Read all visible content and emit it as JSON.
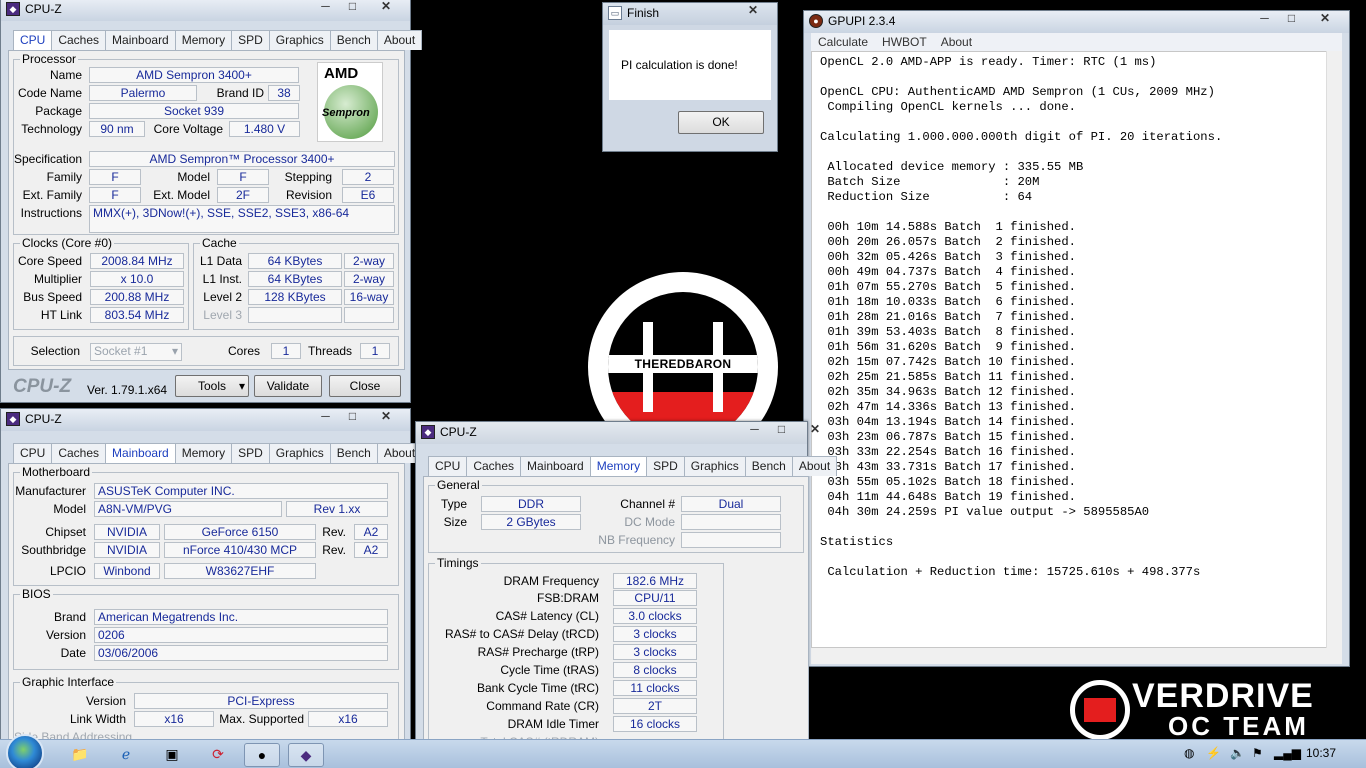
{
  "cpuz_cpu": {
    "title": "CPU-Z",
    "tabs": [
      "CPU",
      "Caches",
      "Mainboard",
      "Memory",
      "SPD",
      "Graphics",
      "Bench",
      "About"
    ],
    "processor_group": "Processor",
    "name_label": "Name",
    "name": "AMD Sempron 3400+",
    "codename_label": "Code Name",
    "codename": "Palermo",
    "brandid_label": "Brand ID",
    "brandid": "38",
    "package_label": "Package",
    "package": "Socket 939",
    "technology_label": "Technology",
    "technology": "90 nm",
    "voltage_label": "Core Voltage",
    "voltage": "1.480 V",
    "spec_label": "Specification",
    "spec": "AMD Sempron™ Processor 3400+",
    "family_label": "Family",
    "family": "F",
    "model_label": "Model",
    "model": "F",
    "stepping_label": "Stepping",
    "stepping": "2",
    "extfamily_label": "Ext. Family",
    "extfamily": "F",
    "extmodel_label": "Ext. Model",
    "extmodel": "2F",
    "revision_label": "Revision",
    "revision": "E6",
    "instructions_label": "Instructions",
    "instructions": "MMX(+), 3DNow!(+), SSE, SSE2, SSE3, x86-64",
    "logo_top": "AMD",
    "logo_bottom": "Sempron",
    "clocks_group": "Clocks (Core #0)",
    "corespeed_label": "Core Speed",
    "corespeed": "2008.84 MHz",
    "multiplier_label": "Multiplier",
    "multiplier": "x 10.0",
    "busspeed_label": "Bus Speed",
    "busspeed": "200.88 MHz",
    "htlink_label": "HT Link",
    "htlink": "803.54 MHz",
    "cache_group": "Cache",
    "l1d_label": "L1 Data",
    "l1d": "64 KBytes",
    "l1d_way": "2-way",
    "l1i_label": "L1 Inst.",
    "l1i": "64 KBytes",
    "l1i_way": "2-way",
    "l2_label": "Level 2",
    "l2": "128 KBytes",
    "l2_way": "16-way",
    "l3_label": "Level 3",
    "selection_label": "Selection",
    "selection": "Socket #1",
    "cores_label": "Cores",
    "cores": "1",
    "threads_label": "Threads",
    "threads": "1",
    "brand": "CPU-Z",
    "version": "Ver. 1.79.1.x64",
    "tools": "Tools",
    "validate": "Validate",
    "close": "Close"
  },
  "finish": {
    "title": "Finish",
    "message": "PI calculation is done!",
    "ok": "OK"
  },
  "gpupi": {
    "title": "GPUPI 2.3.4",
    "menu": [
      "Calculate",
      "HWBOT",
      "About"
    ],
    "log": "OpenCL 2.0 AMD-APP is ready. Timer: RTC (1 ms)\n\nOpenCL CPU: AuthenticAMD AMD Sempron (1 CUs, 2009 MHz)\n Compiling OpenCL kernels ... done.\n\nCalculating 1.000.000.000th digit of PI. 20 iterations.\n\n Allocated device memory : 335.55 MB\n Batch Size              : 20M\n Reduction Size          : 64\n\n 00h 10m 14.588s Batch  1 finished.\n 00h 20m 26.057s Batch  2 finished.\n 00h 32m 05.426s Batch  3 finished.\n 00h 49m 04.737s Batch  4 finished.\n 01h 07m 55.270s Batch  5 finished.\n 01h 18m 10.033s Batch  6 finished.\n 01h 28m 21.016s Batch  7 finished.\n 01h 39m 53.403s Batch  8 finished.\n 01h 56m 31.620s Batch  9 finished.\n 02h 15m 07.742s Batch 10 finished.\n 02h 25m 21.585s Batch 11 finished.\n 02h 35m 34.963s Batch 12 finished.\n 02h 47m 14.336s Batch 13 finished.\n 03h 04m 13.194s Batch 14 finished.\n 03h 23m 06.787s Batch 15 finished.\n 03h 33m 22.254s Batch 16 finished.\n 03h 43m 33.731s Batch 17 finished.\n 03h 55m 05.102s Batch 18 finished.\n 04h 11m 44.648s Batch 19 finished.\n 04h 30m 24.259s PI value output -> 5895585A0\n\nStatistics\n\n Calculation + Reduction time: 15725.610s + 498.377s"
  },
  "cpuz_mb": {
    "title": "CPU-Z",
    "tabs": [
      "CPU",
      "Caches",
      "Mainboard",
      "Memory",
      "SPD",
      "Graphics",
      "Bench",
      "About"
    ],
    "motherboard_group": "Motherboard",
    "manufacturer_label": "Manufacturer",
    "manufacturer": "ASUSTeK Computer INC.",
    "model_label": "Model",
    "model": "A8N-VM/PVG",
    "model_rev": "Rev 1.xx",
    "chipset_label": "Chipset",
    "chipset_vendor": "NVIDIA",
    "chipset": "GeForce 6150",
    "chipset_rev_label": "Rev.",
    "chipset_rev": "A2",
    "southbridge_label": "Southbridge",
    "sb_vendor": "NVIDIA",
    "sb": "nForce 410/430 MCP",
    "sb_rev_label": "Rev.",
    "sb_rev": "A2",
    "lpcio_label": "LPCIO",
    "lpcio_vendor": "Winbond",
    "lpcio": "W83627EHF",
    "bios_group": "BIOS",
    "brand_label": "Brand",
    "brand": "American Megatrends Inc.",
    "version_label": "Version",
    "version": "0206",
    "date_label": "Date",
    "date": "03/06/2006",
    "gi_group": "Graphic Interface",
    "gi_version_label": "Version",
    "gi_version": "PCI-Express",
    "linkwidth_label": "Link Width",
    "linkwidth": "x16",
    "maxsup_label": "Max. Supported",
    "maxsup": "x16",
    "sideband_label": "Side Band Addressing"
  },
  "cpuz_mem": {
    "title": "CPU-Z",
    "tabs": [
      "CPU",
      "Caches",
      "Mainboard",
      "Memory",
      "SPD",
      "Graphics",
      "Bench",
      "About"
    ],
    "general_group": "General",
    "type_label": "Type",
    "type": "DDR",
    "channel_label": "Channel #",
    "channel": "Dual",
    "size_label": "Size",
    "size": "2 GBytes",
    "dcmode_label": "DC Mode",
    "nbfreq_label": "NB Frequency",
    "timings_group": "Timings",
    "dramfreq_label": "DRAM Frequency",
    "dramfreq": "182.6 MHz",
    "fsbdram_label": "FSB:DRAM",
    "fsbdram": "CPU/11",
    "cl_label": "CAS# Latency (CL)",
    "cl": "3.0 clocks",
    "trcd_label": "RAS# to CAS# Delay (tRCD)",
    "trcd": "3 clocks",
    "trp_label": "RAS# Precharge (tRP)",
    "trp": "3 clocks",
    "tras_label": "Cycle Time (tRAS)",
    "tras": "8 clocks",
    "trc_label": "Bank Cycle Time (tRC)",
    "trc": "11 clocks",
    "cr_label": "Command Rate (CR)",
    "cr": "2T",
    "idle_label": "DRAM Idle Timer",
    "idle": "16 clocks",
    "totalcas_label": "Total CAS# (tRDRAM)"
  },
  "wallpaper": {
    "logo_text": "THEREDBARON",
    "team_line1": "VERDRIVE",
    "team_line2": "OC TEAM"
  },
  "taskbar": {
    "clock": "10:37"
  }
}
